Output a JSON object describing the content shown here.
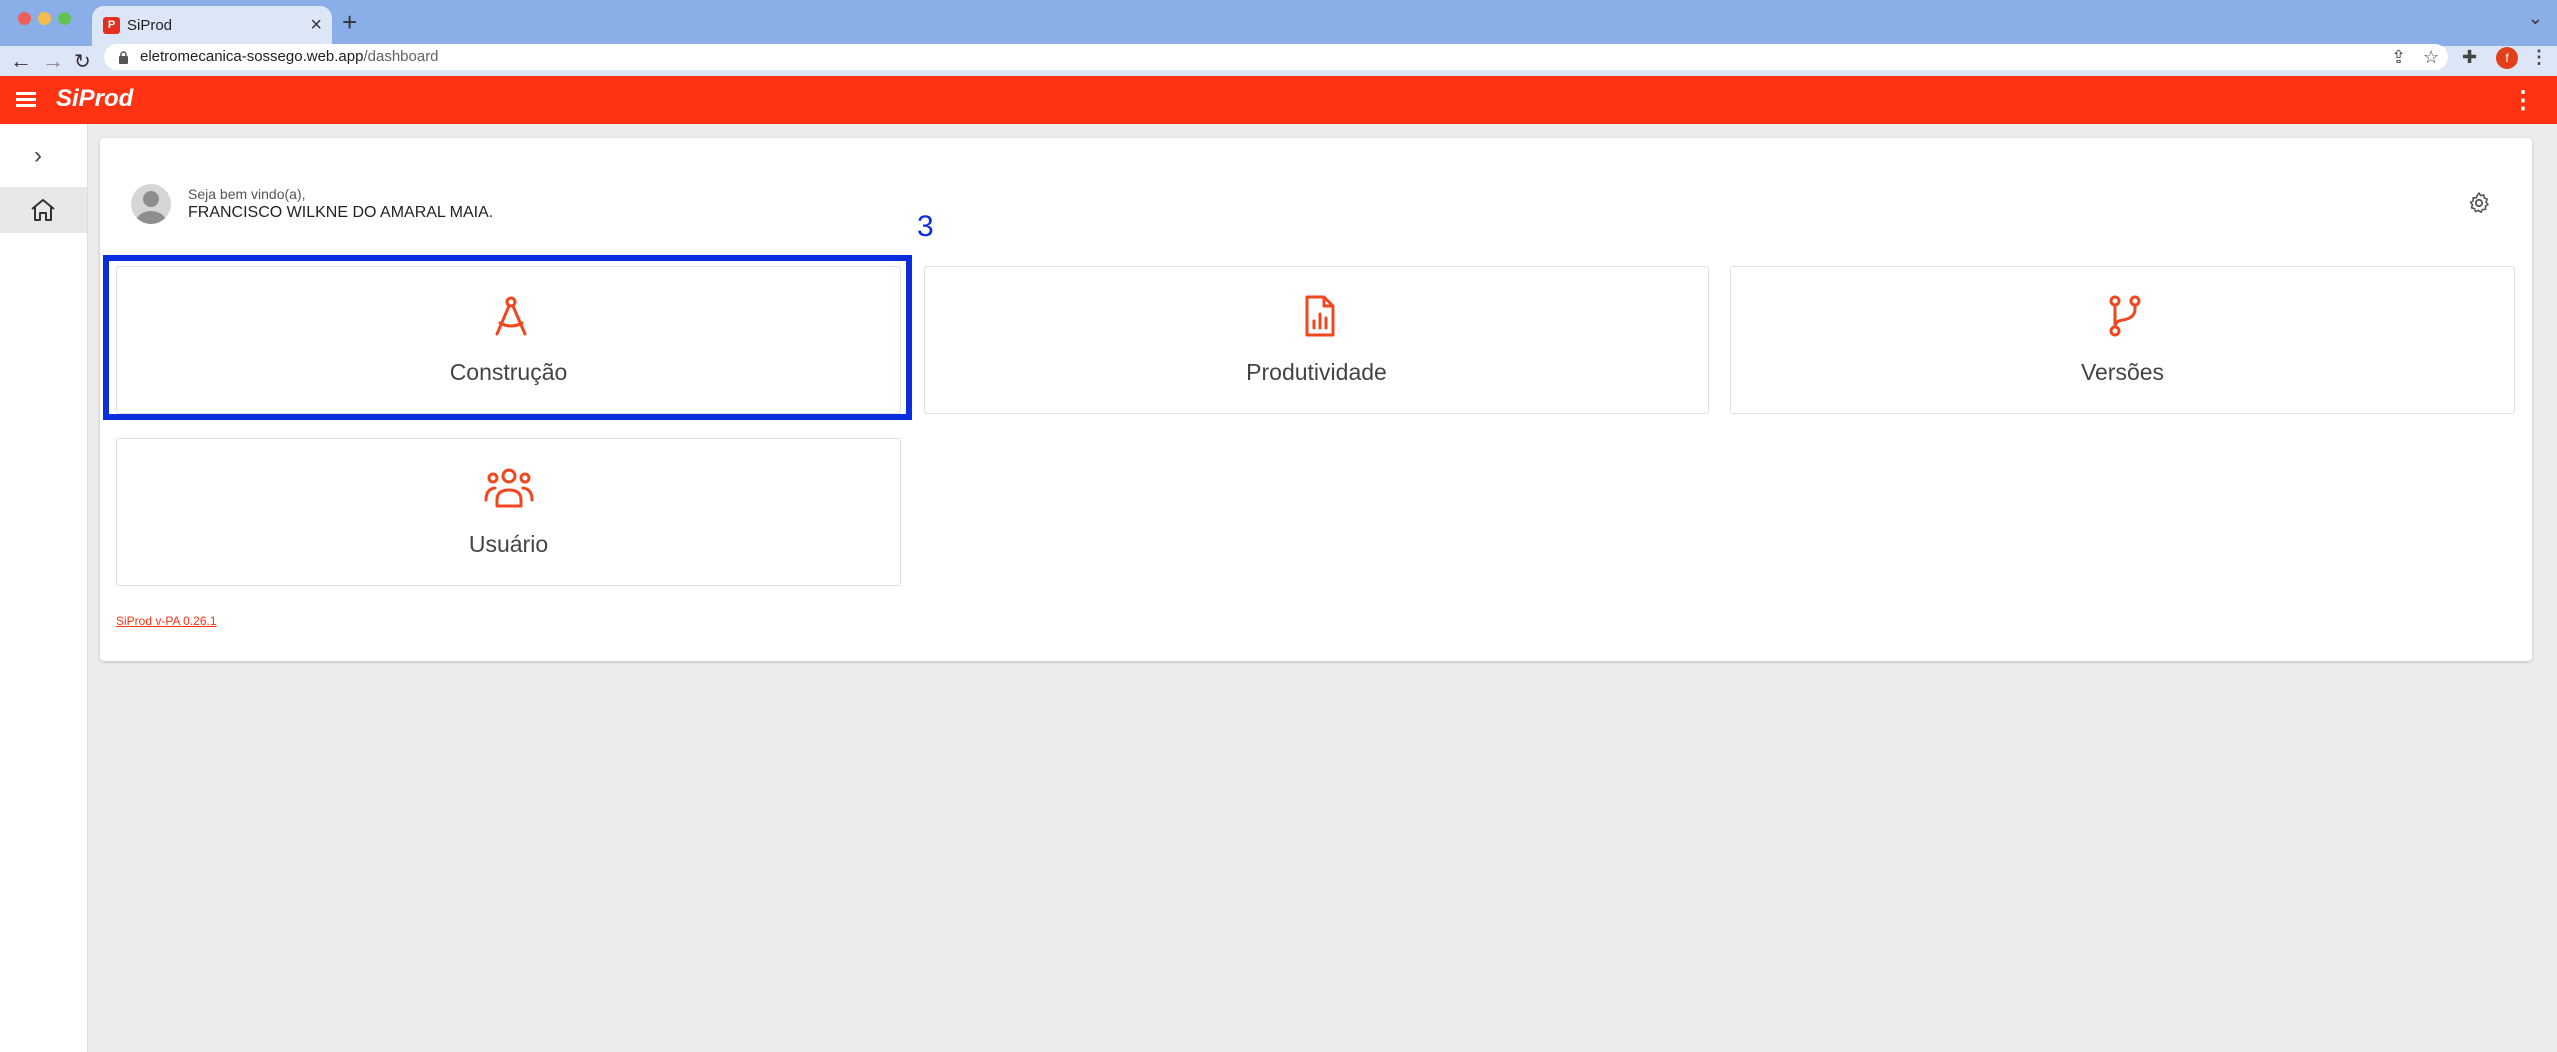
{
  "browser": {
    "tab_title": "SiProd",
    "tab_favicon_letter": "P",
    "url_host": "eletromecanica-sossego.web.app",
    "url_path": "/dashboard",
    "profile_initial": "f"
  },
  "appbar": {
    "logo": "SiProd",
    "color": "#ff3212"
  },
  "sidebar": {
    "items": [
      {
        "icon": "home-icon",
        "active": true
      }
    ]
  },
  "header": {
    "welcome": "Seja bem vindo(a),",
    "user_name": "FRANCISCO WILKNE DO AMARAL MAIA."
  },
  "tiles": [
    {
      "label": "Construção",
      "icon": "compass-drafting-icon"
    },
    {
      "label": "Produtividade",
      "icon": "report-chart-icon"
    },
    {
      "label": "Versões",
      "icon": "git-branch-icon"
    },
    {
      "label": "Usuário",
      "icon": "users-group-icon"
    }
  ],
  "annotation": {
    "number": "3",
    "color": "#0a2de0"
  },
  "footer": {
    "version_link": "SiProd v-PA 0.26.1"
  }
}
